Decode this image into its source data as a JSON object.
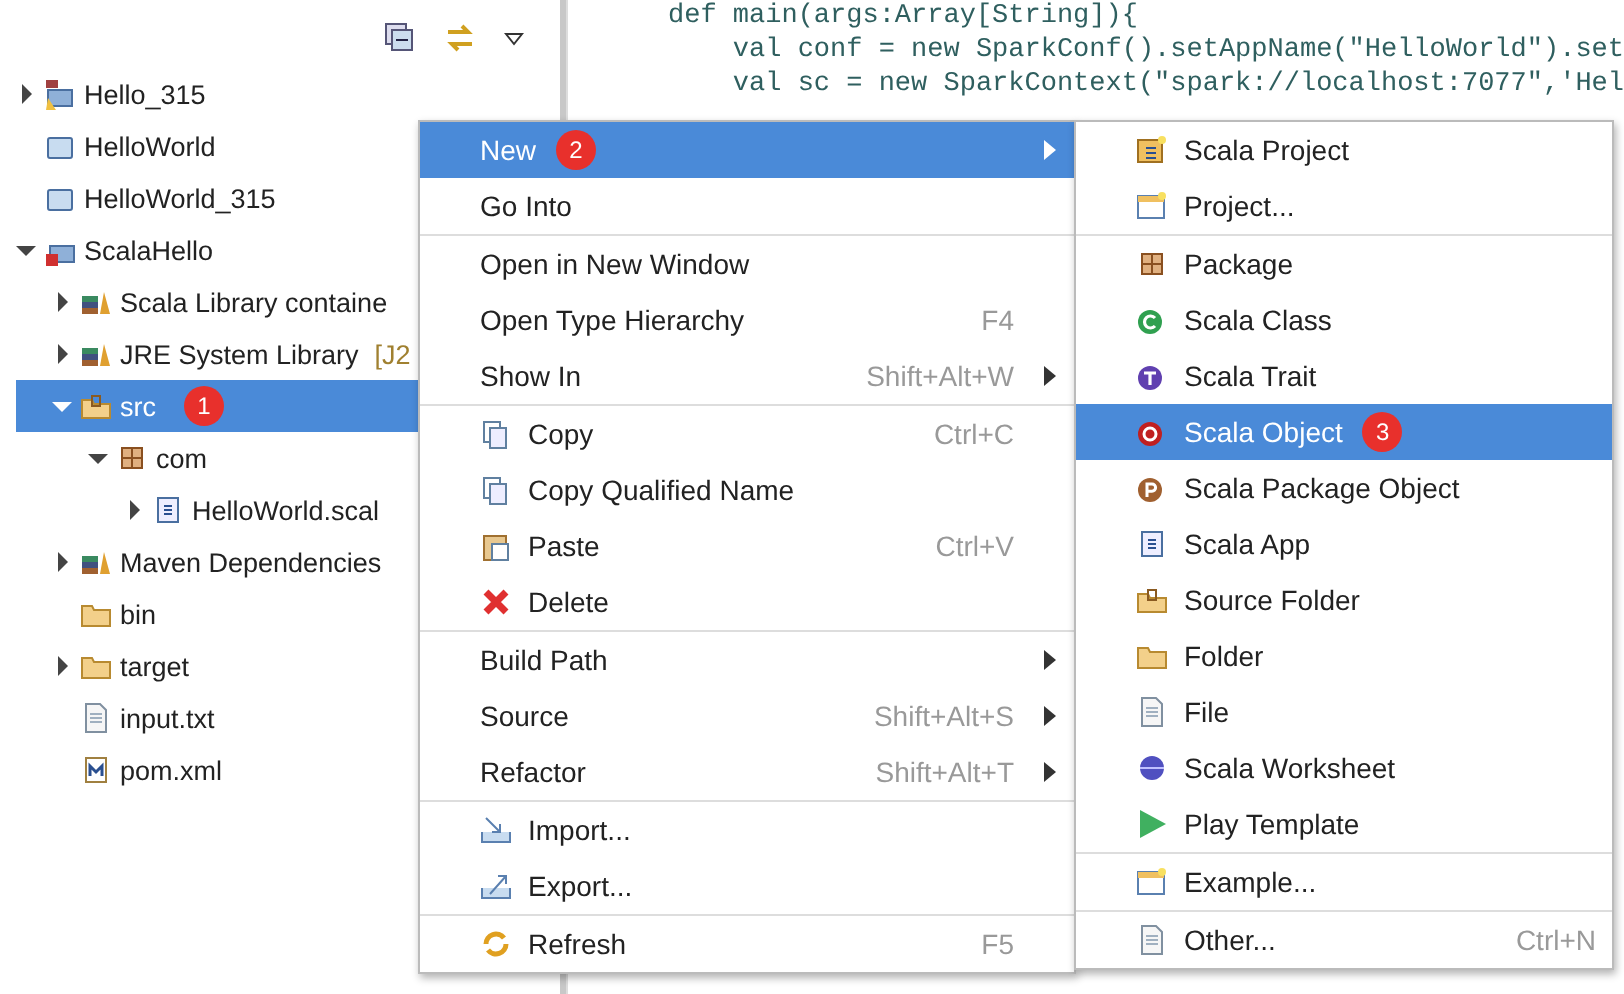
{
  "code_lines": [
    "def main(args:Array[String]){",
    "    val conf = new SparkConf().setAppName(\"HelloWorld\").set",
    "    val sc = new SparkContext(\"spark://localhost:7077\",'Hel"
  ],
  "tree": [
    {
      "label": "Hello_315",
      "kind": "maven-project",
      "expanded": false,
      "selected": false
    },
    {
      "label": "HelloWorld",
      "kind": "closed-project",
      "selected": false
    },
    {
      "label": "HelloWorld_315",
      "kind": "closed-project",
      "selected": false
    },
    {
      "label": "ScalaHello",
      "kind": "maven-project-error",
      "expanded": true,
      "selected": false,
      "children": [
        {
          "label": "Scala Library containe",
          "kind": "library",
          "expanded": false,
          "selected": false
        },
        {
          "label": "JRE System Library",
          "suffix": "[J2",
          "kind": "library",
          "expanded": false,
          "selected": false
        },
        {
          "label": "src",
          "kind": "source-folder",
          "badge": "1",
          "expanded": true,
          "selected": true,
          "children": [
            {
              "label": "com",
              "kind": "package",
              "expanded": true,
              "selected": false,
              "children": [
                {
                  "label": "HelloWorld.scal",
                  "kind": "scala-file",
                  "expanded": false,
                  "selected": false
                }
              ]
            }
          ]
        },
        {
          "label": "Maven Dependencies",
          "kind": "library",
          "expanded": false,
          "selected": false
        },
        {
          "label": "bin",
          "kind": "folder",
          "selected": false
        },
        {
          "label": "target",
          "kind": "folder",
          "expanded": false,
          "selected": false
        },
        {
          "label": "input.txt",
          "kind": "text-file",
          "selected": false
        },
        {
          "label": "pom.xml",
          "kind": "maven-file",
          "selected": false
        }
      ]
    }
  ],
  "context_menu": [
    {
      "label": "New",
      "kind": "plain",
      "badge": "2",
      "submenu": true,
      "selected": true
    },
    {
      "label": "Go Into",
      "kind": "plain",
      "selected": false
    },
    {
      "label": "Open in New Window",
      "kind": "plain",
      "separator_before": true,
      "selected": false
    },
    {
      "label": "Open Type Hierarchy",
      "kind": "plain",
      "shortcut": "F4",
      "selected": false
    },
    {
      "label": "Show In",
      "kind": "plain",
      "shortcut": "Shift+Alt+W",
      "submenu": true,
      "selected": false
    },
    {
      "label": "Copy",
      "kind": "copy",
      "shortcut": "Ctrl+C",
      "separator_before": true,
      "selected": false
    },
    {
      "label": "Copy Qualified Name",
      "kind": "copy",
      "selected": false
    },
    {
      "label": "Paste",
      "kind": "paste",
      "shortcut": "Ctrl+V",
      "selected": false
    },
    {
      "label": "Delete",
      "kind": "delete",
      "selected": false
    },
    {
      "label": "Build Path",
      "kind": "plain",
      "submenu": true,
      "separator_before": true,
      "selected": false
    },
    {
      "label": "Source",
      "kind": "plain",
      "shortcut": "Shift+Alt+S",
      "submenu": true,
      "selected": false
    },
    {
      "label": "Refactor",
      "kind": "plain",
      "shortcut": "Shift+Alt+T",
      "submenu": true,
      "selected": false
    },
    {
      "label": "Import...",
      "kind": "import",
      "separator_before": true,
      "selected": false
    },
    {
      "label": "Export...",
      "kind": "export",
      "selected": false
    },
    {
      "label": "Refresh",
      "kind": "refresh",
      "shortcut": "F5",
      "separator_before": true,
      "selected": false
    }
  ],
  "new_submenu": [
    {
      "label": "Scala Project",
      "kind": "scala-project",
      "selected": false
    },
    {
      "label": "Project...",
      "kind": "wizard",
      "selected": false
    },
    {
      "label": "Package",
      "kind": "package",
      "separator_before": true,
      "selected": false
    },
    {
      "label": "Scala Class",
      "kind": "class",
      "selected": false
    },
    {
      "label": "Scala Trait",
      "kind": "trait",
      "selected": false
    },
    {
      "label": "Scala Object",
      "kind": "object",
      "badge": "3",
      "selected": true
    },
    {
      "label": "Scala Package Object",
      "kind": "package-object",
      "selected": false
    },
    {
      "label": "Scala App",
      "kind": "scala-file",
      "selected": false
    },
    {
      "label": "Source Folder",
      "kind": "source-folder",
      "selected": false
    },
    {
      "label": "Folder",
      "kind": "folder",
      "selected": false
    },
    {
      "label": "File",
      "kind": "text-file",
      "selected": false
    },
    {
      "label": "Scala Worksheet",
      "kind": "worksheet",
      "selected": false
    },
    {
      "label": "Play Template",
      "kind": "play",
      "selected": false
    },
    {
      "label": "Example...",
      "kind": "wizard",
      "separator_before": true,
      "selected": false
    },
    {
      "label": "Other...",
      "kind": "text-file",
      "shortcut": "Ctrl+N",
      "separator_before": true,
      "selected": false
    }
  ]
}
